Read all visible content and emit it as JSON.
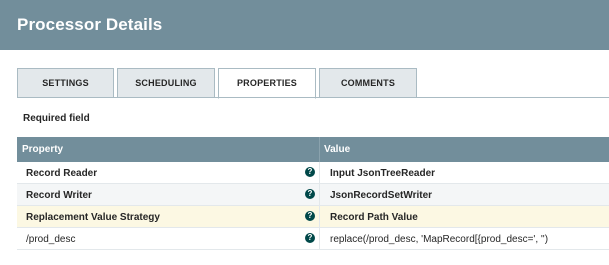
{
  "dialog": {
    "title": "Processor Details"
  },
  "tabs": [
    {
      "label": "SETTINGS"
    },
    {
      "label": "SCHEDULING"
    },
    {
      "label": "PROPERTIES",
      "active": true
    },
    {
      "label": "COMMENTS"
    }
  ],
  "required_field_label": "Required field",
  "table": {
    "columns": [
      "Property",
      "Value"
    ],
    "rows": [
      {
        "property": "Record Reader",
        "value": "Input JsonTreeReader",
        "help_icon": "question-circle-icon"
      },
      {
        "property": "Record Writer",
        "value": "JsonRecordSetWriter",
        "help_icon": "question-circle-icon"
      },
      {
        "property": "Replacement Value Strategy",
        "value": "Record Path Value",
        "help_icon": "question-circle-icon"
      },
      {
        "property": "/prod_desc",
        "value": "replace(/prod_desc, 'MapRecord[{prod_desc=', '')",
        "help_icon": "question-circle-icon"
      }
    ]
  },
  "colors": {
    "header_bg": "#728e9b",
    "tab_bg": "#e3e8eb",
    "selected_row_bg": "#fcf8e3",
    "help_icon_bg": "#004849"
  }
}
